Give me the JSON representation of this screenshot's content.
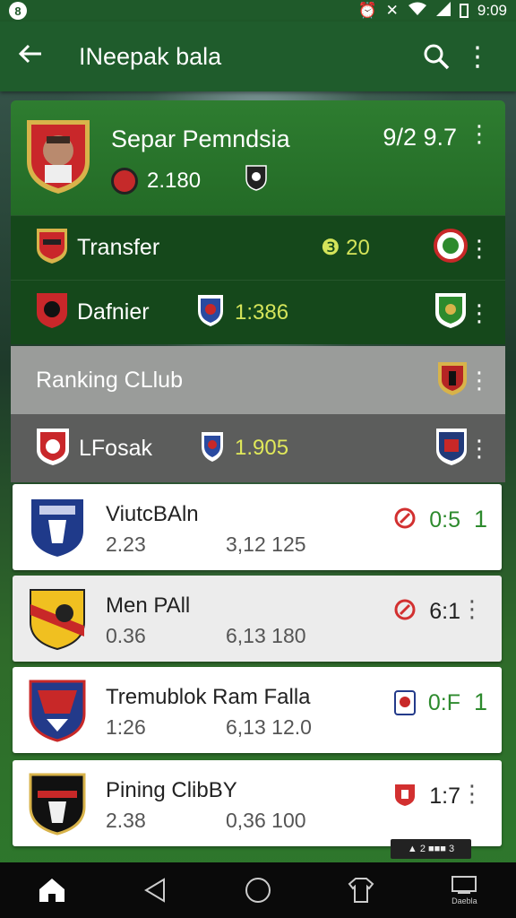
{
  "status_bar": {
    "left": "8",
    "time": "9:09"
  },
  "app_bar": {
    "title": "INeepak bala"
  },
  "hero": {
    "player_name": "Separ Pemndsia",
    "stat": "2.180",
    "score": "9/2 9.7"
  },
  "dark_rows": [
    {
      "label": "Transfer",
      "value": "❸ 20"
    },
    {
      "label": "Dafnier",
      "value": "1:386"
    }
  ],
  "section": {
    "label": "Ranking CLlub"
  },
  "grey_row": {
    "label": "LFosak",
    "value": "1.905"
  },
  "cards": [
    {
      "name": "ViutcBAln",
      "num1": "2.23",
      "num2": "3,12 125",
      "score": "0:5",
      "trail": "1"
    },
    {
      "name": "Men PAll",
      "num1": "0.36",
      "num2": "6,13 180",
      "score": "6:1",
      "trail": "⋮"
    },
    {
      "name": "Tremublok Ram Falla",
      "num1": "1:26",
      "num2": "6,13 12.0",
      "score": "0:F",
      "trail": "1"
    },
    {
      "name": "Pining ClibBY",
      "num1": "2.38",
      "num2": "0,36 100",
      "score": "1:7",
      "trail": "⋮"
    }
  ],
  "toast": {
    "text": "▲ 2 ■■■ 3"
  },
  "navbar": {
    "last_label": "Daebla"
  },
  "colors": {
    "app_bar": "#1f5c2c",
    "hero": "#2e7d30",
    "accent_yellow": "#d4e45a",
    "score_green": "#2d8a2d"
  }
}
